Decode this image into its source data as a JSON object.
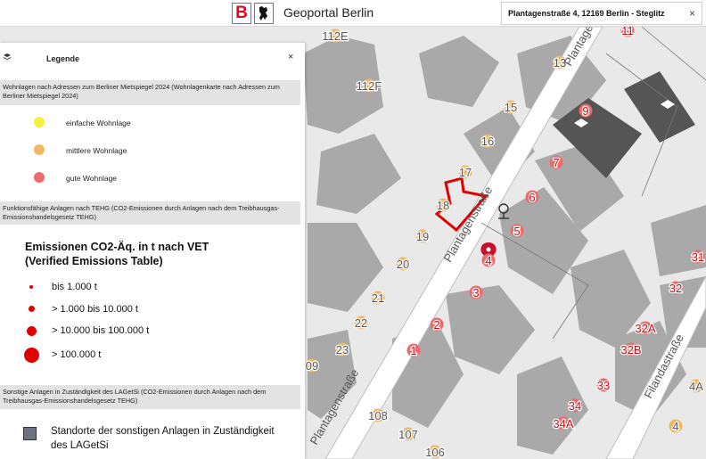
{
  "header": {
    "logo_letter": "B",
    "portal_title": "Geoportal Berlin",
    "search_value": "Plantagenstraße 4, 12169 Berlin - Steglitz",
    "close_symbol": "×"
  },
  "legend": {
    "title": "Legende",
    "close_symbol": "×",
    "sections": {
      "mietspiegel": {
        "title": "Wohnlagen nach Adressen zum Berliner Mietspiegel 2024 (Wohnlagenkarte nach Adressen zum Berliner Mietspiegel 2024)",
        "entries": [
          {
            "label": "einfache Wohnlage",
            "color": "#f5f03c"
          },
          {
            "label": "mittlere Wohnlage",
            "color": "#f2b765"
          },
          {
            "label": "gute Wohnlage",
            "color": "#ef6b6b"
          }
        ]
      },
      "tehg": {
        "title": "Funktionsfähige Anlagen nach TEHG (CO2-Emissionen durch Anlagen nach dem Treibhausgas-Emissionshandelsgesetz TEHG)",
        "emission_title": "Emissionen CO2-Äq. in t nach VET (Verified Emissions Table)",
        "entries": [
          {
            "label": "bis 1.000 t"
          },
          {
            "label": "> 1.000 bis 10.000 t"
          },
          {
            "label": "> 10.000 bis 100.000 t"
          },
          {
            "label": "> 100.000 t"
          }
        ],
        "color": "#e00000"
      },
      "lagetsi": {
        "title": "Sonstige Anlagen in Zuständigkeit des LAGetSi (CO2-Emissionen durch Anlagen nach dem Treibhausgas-Emissionshandelsgesetz TEHG)",
        "entries": [
          {
            "label": "Standorte der sonstigen Anlagen in Zuständigkeit des LAGetSi",
            "color": "#6b7480"
          }
        ]
      }
    }
  },
  "map": {
    "streets": [
      "Plantagenstraße",
      "Filandastraße"
    ],
    "addresses": [
      {
        "label": "112E",
        "kind": "mittel"
      },
      {
        "label": "112F",
        "kind": "mittel"
      },
      {
        "label": "11",
        "kind": "gut"
      },
      {
        "label": "13",
        "kind": "mittel"
      },
      {
        "label": "15",
        "kind": "mittel"
      },
      {
        "label": "16",
        "kind": "mittel"
      },
      {
        "label": "17",
        "kind": "mittel"
      },
      {
        "label": "18",
        "kind": "mittel"
      },
      {
        "label": "19",
        "kind": "mittel"
      },
      {
        "label": "20",
        "kind": "mittel"
      },
      {
        "label": "21",
        "kind": "mittel"
      },
      {
        "label": "22",
        "kind": "mittel"
      },
      {
        "label": "23",
        "kind": "mittel"
      },
      {
        "label": "9",
        "kind": "gut"
      },
      {
        "label": "7",
        "kind": "gut"
      },
      {
        "label": "6",
        "kind": "gut"
      },
      {
        "label": "5",
        "kind": "gut"
      },
      {
        "label": "4",
        "kind": "gut"
      },
      {
        "label": "3",
        "kind": "gut"
      },
      {
        "label": "2",
        "kind": "gut"
      },
      {
        "label": "1",
        "kind": "gut"
      },
      {
        "label": "31",
        "kind": "gut"
      },
      {
        "label": "32",
        "kind": "gut"
      },
      {
        "label": "32A",
        "kind": "gut"
      },
      {
        "label": "32B",
        "kind": "gut"
      },
      {
        "label": "33",
        "kind": "gut"
      },
      {
        "label": "34",
        "kind": "gut"
      },
      {
        "label": "34A",
        "kind": "gut"
      },
      {
        "label": "4A",
        "kind": "mittel"
      },
      {
        "label": "4",
        "kind": "mittel"
      },
      {
        "label": "108",
        "kind": "mittel"
      },
      {
        "label": "107",
        "kind": "mittel"
      },
      {
        "label": "106",
        "kind": "mittel"
      },
      {
        "label": "09",
        "kind": "mittel"
      }
    ]
  }
}
